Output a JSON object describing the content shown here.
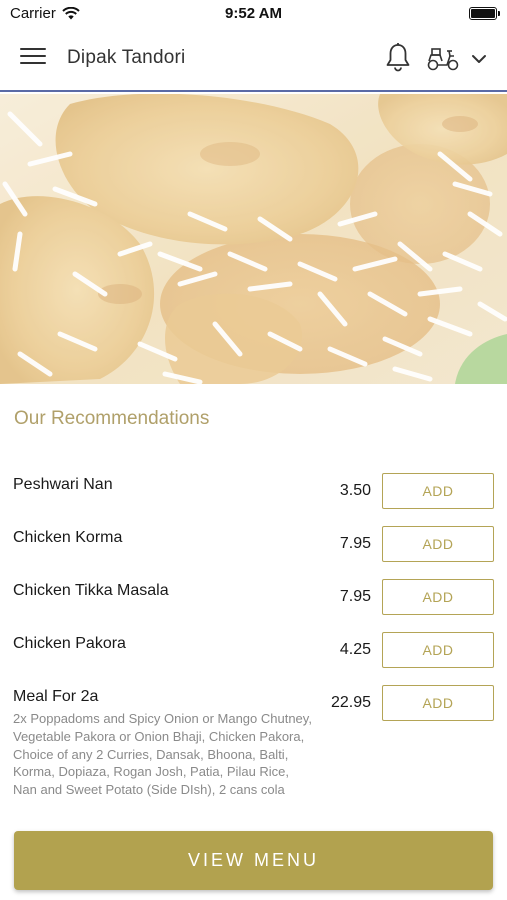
{
  "status_bar": {
    "carrier": "Carrier",
    "time": "9:52 AM"
  },
  "header": {
    "title": "Dipak Tandori",
    "icons": [
      "menu-icon",
      "bell-icon",
      "scooter-icon",
      "chevron-down-icon"
    ]
  },
  "section": {
    "title": "Our Recommendations"
  },
  "items": [
    {
      "name": "Peshwari Nan",
      "price": "3.50",
      "button": "ADD"
    },
    {
      "name": "Chicken Korma",
      "price": "7.95",
      "button": "ADD"
    },
    {
      "name": "Chicken Tikka Masala",
      "price": "7.95",
      "button": "ADD"
    },
    {
      "name": "Chicken Pakora",
      "price": "4.25",
      "button": "ADD"
    },
    {
      "name": "Meal For 2a",
      "price": "22.95",
      "button": "ADD",
      "description": "2x Poppadoms and Spicy Onion or Mango Chutney, Vegetable Pakora or Onion Bhaji, Chicken Pakora, Choice of any 2 Curries, Dansak, Bhoona, Balti, Korma, Dopiaza, Rogan Josh, Patia, Pilau Rice, Nan and Sweet Potato (Side DIsh), 2 cans cola"
    }
  ],
  "footer": {
    "button": "VIEW MENU"
  },
  "colors": {
    "accent": "#b2a24f",
    "header_border": "#5a6aa6",
    "section_title": "#b0a06a"
  }
}
